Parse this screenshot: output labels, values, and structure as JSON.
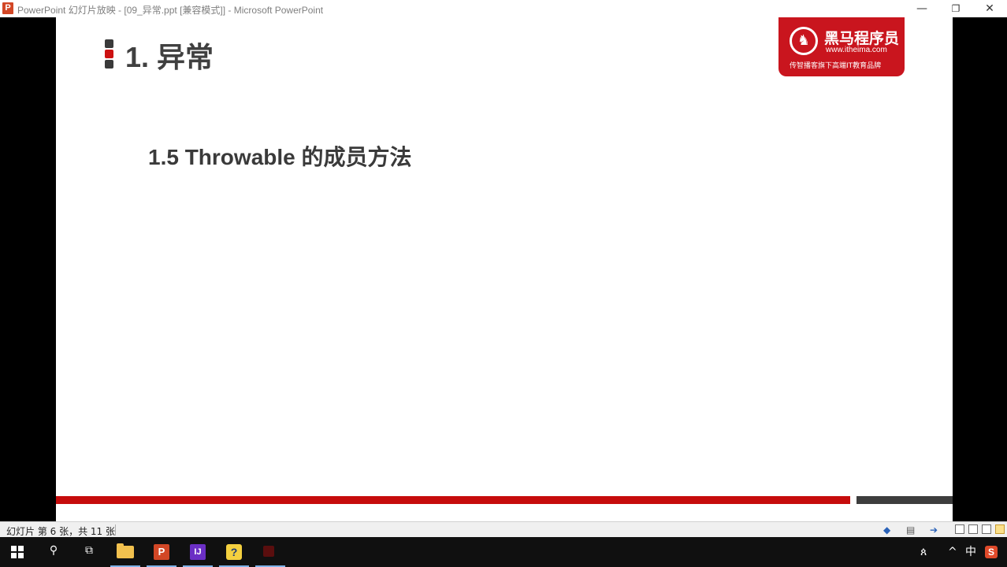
{
  "window": {
    "app_icon_letter": "P",
    "title": "PowerPoint 幻灯片放映 - [09_异常.ppt [兼容模式]] - Microsoft PowerPoint",
    "minimize_glyph": "—",
    "restore_glyph": "❐",
    "close_glyph": "✕"
  },
  "slide": {
    "heading": "1. 异常",
    "subheading": "1.5 Throwable 的成员方法",
    "logo": {
      "name": "黑马程序员",
      "url": "www.itheima.com",
      "slogan": "传智播客旗下高端IT教育品牌",
      "accent": "#c9151e"
    },
    "progress": {
      "current": 6,
      "total": 11,
      "bar_color": "#c60c0c"
    }
  },
  "statusbar": {
    "slide_info": "幻灯片 第 6 张，共 11 张",
    "icons": [
      "previous-arrow-icon",
      "notes-icon",
      "next-arrow-icon"
    ],
    "view_buttons": [
      "normal-view",
      "slide-sorter-view",
      "reading-view",
      "slide-show-view"
    ]
  },
  "taskbar": {
    "apps": [
      "start",
      "search",
      "task-view",
      "file-explorer",
      "powerpoint",
      "intellij-idea",
      "python",
      "unknown-app"
    ],
    "ppt_letter": "P",
    "ij_letter": "IJ",
    "py_letter": "?",
    "tray": {
      "people": "ጰ",
      "chevron": "^",
      "ime": "中",
      "sogou": "S"
    }
  }
}
